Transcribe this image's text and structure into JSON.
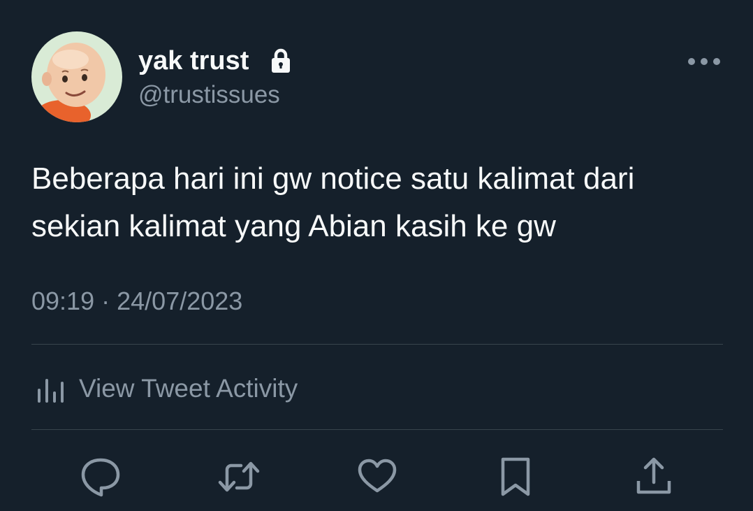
{
  "author": {
    "display_name": "yak trust",
    "handle": "@trustissues",
    "protected_icon": "lock-icon",
    "avatar": "cartoon-boy-avatar"
  },
  "tweet": {
    "lines": [
      "Beberapa hari ini gw notice satu kalimat dari",
      "sekian kalimat yang Abian kasih ke gw"
    ],
    "time": "09:19",
    "separator": "·",
    "date": "24/07/2023"
  },
  "activity": {
    "label": "View Tweet Activity",
    "icon": "analytics-icon"
  },
  "actions": [
    {
      "name": "reply",
      "icon": "reply-icon"
    },
    {
      "name": "retweet",
      "icon": "retweet-icon"
    },
    {
      "name": "like",
      "icon": "heart-icon"
    },
    {
      "name": "bookmark",
      "icon": "bookmark-icon"
    },
    {
      "name": "share",
      "icon": "share-icon"
    }
  ],
  "colors": {
    "background": "#15202b",
    "primary_text": "#f7f9f9",
    "secondary_text": "#8b98a5",
    "divider": "#38444d"
  }
}
